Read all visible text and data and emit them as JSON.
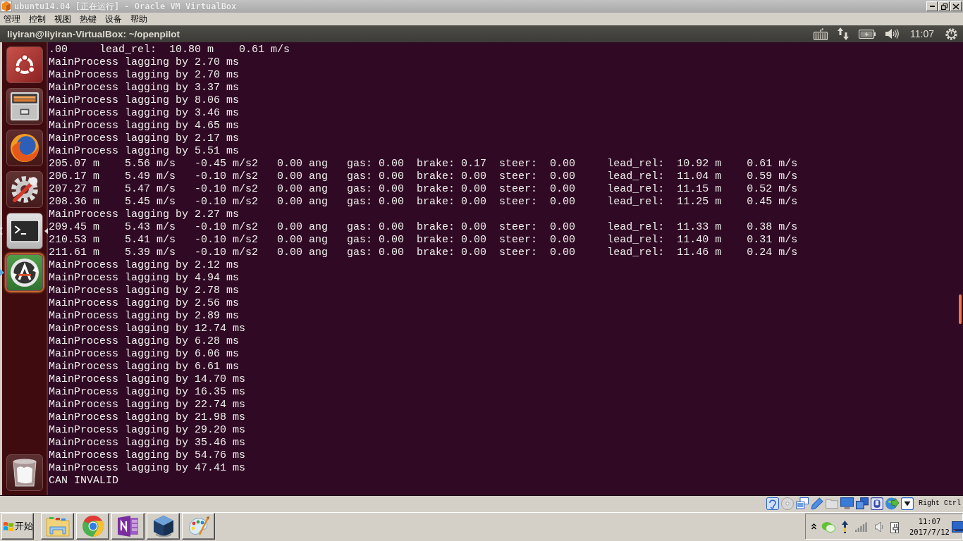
{
  "window": {
    "title": "ubuntu14.04 [正在运行] - Oracle VM VirtualBox"
  },
  "menu_bar": [
    "管理",
    "控制",
    "视图",
    "热键",
    "设备",
    "帮助"
  ],
  "top_panel": {
    "title": "liyiran@liyiran-VirtualBox: ~/openpilot",
    "clock": "11:07"
  },
  "launcher": {
    "items": [
      {
        "kind": "dash",
        "running": false,
        "focused": false,
        "urgent": false
      },
      {
        "kind": "files",
        "running": false,
        "focused": false,
        "urgent": false
      },
      {
        "kind": "firefox",
        "running": false,
        "focused": false,
        "urgent": false
      },
      {
        "kind": "settings",
        "running": false,
        "focused": false,
        "urgent": false
      },
      {
        "kind": "terminal",
        "running": true,
        "focused": true,
        "urgent": false
      },
      {
        "kind": "updater",
        "running": false,
        "focused": false,
        "urgent": true
      },
      {
        "kind": "trash",
        "running": false,
        "focused": false,
        "urgent": false
      }
    ]
  },
  "terminal": {
    "lines": [
      ".00     lead_rel:  10.80 m    0.61 m/s",
      "MainProcess lagging by 2.70 ms",
      "MainProcess lagging by 2.70 ms",
      "MainProcess lagging by 3.37 ms",
      "MainProcess lagging by 8.06 ms",
      "MainProcess lagging by 3.46 ms",
      "MainProcess lagging by 4.65 ms",
      "MainProcess lagging by 2.17 ms",
      "MainProcess lagging by 5.51 ms",
      "205.07 m    5.56 m/s   -0.45 m/s2   0.00 ang   gas: 0.00  brake: 0.17  steer:  0.00     lead_rel:  10.92 m    0.61 m/s",
      "206.17 m    5.49 m/s   -0.10 m/s2   0.00 ang   gas: 0.00  brake: 0.00  steer:  0.00     lead_rel:  11.04 m    0.59 m/s",
      "207.27 m    5.47 m/s   -0.10 m/s2   0.00 ang   gas: 0.00  brake: 0.00  steer:  0.00     lead_rel:  11.15 m    0.52 m/s",
      "208.36 m    5.45 m/s   -0.10 m/s2   0.00 ang   gas: 0.00  brake: 0.00  steer:  0.00     lead_rel:  11.25 m    0.45 m/s",
      "MainProcess lagging by 2.27 ms",
      "209.45 m    5.43 m/s   -0.10 m/s2   0.00 ang   gas: 0.00  brake: 0.00  steer:  0.00     lead_rel:  11.33 m    0.38 m/s",
      "210.53 m    5.41 m/s   -0.10 m/s2   0.00 ang   gas: 0.00  brake: 0.00  steer:  0.00     lead_rel:  11.40 m    0.31 m/s",
      "211.61 m    5.39 m/s   -0.10 m/s2   0.00 ang   gas: 0.00  brake: 0.00  steer:  0.00     lead_rel:  11.46 m    0.24 m/s",
      "MainProcess lagging by 2.12 ms",
      "MainProcess lagging by 4.94 ms",
      "MainProcess lagging by 2.78 ms",
      "MainProcess lagging by 2.56 ms",
      "MainProcess lagging by 2.89 ms",
      "MainProcess lagging by 12.74 ms",
      "MainProcess lagging by 6.28 ms",
      "MainProcess lagging by 6.06 ms",
      "MainProcess lagging by 6.61 ms",
      "MainProcess lagging by 14.70 ms",
      "MainProcess lagging by 16.35 ms",
      "MainProcess lagging by 22.74 ms",
      "MainProcess lagging by 21.98 ms",
      "MainProcess lagging by 29.20 ms",
      "MainProcess lagging by 35.46 ms",
      "MainProcess lagging by 54.76 ms",
      "MainProcess lagging by 47.41 ms",
      "CAN INVALID"
    ]
  },
  "status_bar": {
    "host_key": "Right Ctrl"
  },
  "taskbar": {
    "start_label": "开始",
    "apps": [
      {
        "kind": "explorer"
      },
      {
        "kind": "chrome"
      },
      {
        "kind": "onenote"
      },
      {
        "kind": "virtualbox"
      },
      {
        "kind": "paint"
      }
    ],
    "tray": {
      "time": "11:07",
      "date": "2017/7/12"
    }
  }
}
